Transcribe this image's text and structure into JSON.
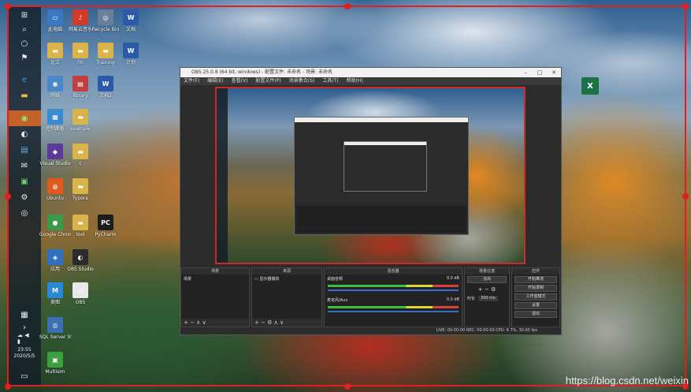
{
  "obs": {
    "title": "OBS 25.0.8 (64 bit, windows) - 配置文件: 未命名 - 场景: 未命名",
    "menu": [
      "文件(F)",
      "编辑(E)",
      "查看(V)",
      "配置文件(P)",
      "场景集合(S)",
      "工具(T)",
      "帮助(H)"
    ],
    "docks": {
      "scenes": {
        "header": "场景",
        "item": "场景"
      },
      "sources": {
        "header": "来源",
        "item": "显示器捕获"
      },
      "mixer": {
        "header": "混音器",
        "ch1": "桌面音频",
        "ch1_db": "0.0 dB",
        "ch2": "麦克风/Aux",
        "ch2_db": "0.0 dB"
      },
      "transitions": {
        "header": "场景过渡",
        "type": "淡出",
        "duration_label": "时长",
        "duration": "300 ms"
      },
      "controls": {
        "header": "控件",
        "buttons": [
          "开始推流",
          "开始录制",
          "工作室模式",
          "设置",
          "退出"
        ]
      }
    },
    "status": "LIVE: 00:00:00   REC: 00:00:00   CPU: 6.7%, 30.00 fps"
  },
  "desktop_icons": [
    {
      "id": "pc",
      "label": "此电脑",
      "color": "#3a78c2",
      "glyph": "▭"
    },
    {
      "id": "app-red",
      "label": "网易云音乐",
      "color": "#d23a2a",
      "glyph": "♪"
    },
    {
      "id": "rec",
      "label": "Recycle Bin",
      "color": "#6a7f9a",
      "glyph": "◎"
    },
    {
      "id": "word1",
      "label": "文档",
      "color": "#2b5aa8",
      "glyph": "W"
    },
    {
      "id": "folder1",
      "label": "论文",
      "color": "#d9b44a",
      "glyph": "▬"
    },
    {
      "id": "folder2",
      "label": "hh",
      "color": "#d9b44a",
      "glyph": "▬"
    },
    {
      "id": "folder3",
      "label": "Training",
      "color": "#d9b44a",
      "glyph": "▬"
    },
    {
      "id": "word2",
      "label": "计划",
      "color": "#2b5aa8",
      "glyph": "W"
    },
    {
      "id": "net",
      "label": "网络",
      "color": "#4a88c8",
      "glyph": "◉"
    },
    {
      "id": "lib",
      "label": "library",
      "color": "#c04040",
      "glyph": "▤"
    },
    {
      "id": "word3",
      "label": "文档2",
      "color": "#2b5aa8",
      "glyph": "W"
    },
    {
      "id": "ctrl",
      "label": "控制面板",
      "color": "#3a8ad0",
      "glyph": "▦"
    },
    {
      "id": "folder4",
      "label": "example",
      "color": "#d9b44a",
      "glyph": "▬"
    },
    {
      "id": "vs",
      "label": "Visual Studio",
      "color": "#5a3a9a",
      "glyph": "◆"
    },
    {
      "id": "folder5",
      "label": "c",
      "color": "#d9b44a",
      "glyph": "▬"
    },
    {
      "id": "ubuntu",
      "label": "Ubuntu",
      "color": "#e05a20",
      "glyph": "◍"
    },
    {
      "id": "folder6",
      "label": "Typora",
      "color": "#d9b44a",
      "glyph": "▬"
    },
    {
      "id": "chrome",
      "label": "Google Chrome",
      "color": "#3a9a4a",
      "glyph": "●"
    },
    {
      "id": "folder7",
      "label": "tool",
      "color": "#d9b44a",
      "glyph": "▬"
    },
    {
      "id": "pycharm",
      "label": "PyCharm",
      "color": "#1d1d1d",
      "glyph": "PC"
    },
    {
      "id": "app-blue",
      "label": "应用",
      "color": "#2f6fc0",
      "glyph": "◈"
    },
    {
      "id": "obs",
      "label": "OBS Studio",
      "color": "#2b2b2b",
      "glyph": "◐"
    },
    {
      "id": "meitu",
      "label": "美图",
      "color": "#2a88d8",
      "glyph": "M"
    },
    {
      "id": "doc",
      "label": "OBS",
      "color": "#e8e8e8",
      "glyph": "▭"
    },
    {
      "id": "vsc",
      "label": "SQL Server Studio",
      "color": "#3a6fb0",
      "glyph": "◎"
    },
    {
      "id": "multi",
      "label": "Multisim",
      "color": "#3aa040",
      "glyph": "▣"
    }
  ],
  "taskbar": {
    "time": "23:55",
    "date": "2020/5/5"
  },
  "watermark": "https://blog.csdn.net/weixin"
}
